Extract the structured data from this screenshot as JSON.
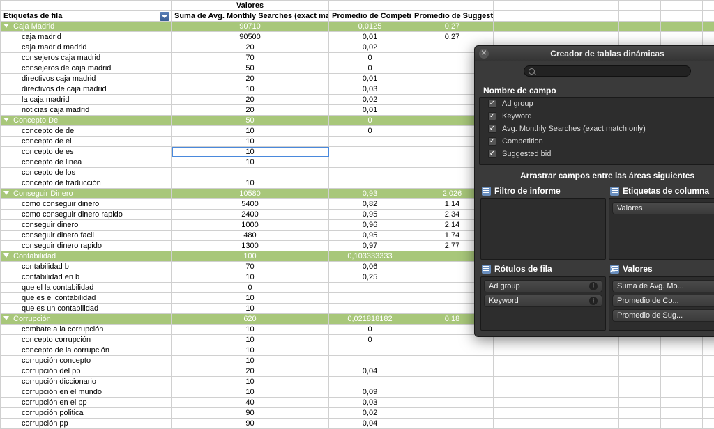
{
  "headers": {
    "row_labels": "Etiquetas de fila",
    "values": "Valores",
    "col_b": "Suma de Avg. Monthly Searches (exact match only)",
    "col_c": "Promedio de Competition",
    "col_d": "Promedio de Suggested bid"
  },
  "rows": [
    {
      "type": "group",
      "label": "Caja Madrid",
      "b": "90710",
      "c": "0,0125",
      "d": "0,27"
    },
    {
      "type": "child",
      "label": "caja madrid",
      "b": "90500",
      "c": "0,01",
      "d": "0,27"
    },
    {
      "type": "child",
      "label": "caja madrid madrid",
      "b": "20",
      "c": "0,02",
      "d": ""
    },
    {
      "type": "child",
      "label": "consejeros caja madrid",
      "b": "70",
      "c": "0",
      "d": ""
    },
    {
      "type": "child",
      "label": "consejeros de caja madrid",
      "b": "50",
      "c": "0",
      "d": ""
    },
    {
      "type": "child",
      "label": "directivos caja madrid",
      "b": "20",
      "c": "0,01",
      "d": ""
    },
    {
      "type": "child",
      "label": "directivos de caja madrid",
      "b": "10",
      "c": "0,03",
      "d": ""
    },
    {
      "type": "child",
      "label": "la caja madrid",
      "b": "20",
      "c": "0,02",
      "d": ""
    },
    {
      "type": "child",
      "label": "noticias caja madrid",
      "b": "20",
      "c": "0,01",
      "d": ""
    },
    {
      "type": "group",
      "label": "Concepto De",
      "b": "50",
      "c": "0",
      "d": ""
    },
    {
      "type": "child",
      "label": "concepto de de",
      "b": "10",
      "c": "0",
      "d": ""
    },
    {
      "type": "child",
      "label": "concepto de el",
      "b": "10",
      "c": "",
      "d": ""
    },
    {
      "type": "child",
      "label": "concepto de es",
      "b": "10",
      "c": "",
      "d": "",
      "selected": true
    },
    {
      "type": "child",
      "label": "concepto de linea",
      "b": "10",
      "c": "",
      "d": ""
    },
    {
      "type": "child",
      "label": "concepto de los",
      "b": "",
      "c": "",
      "d": ""
    },
    {
      "type": "child",
      "label": "concepto de traducción",
      "b": "10",
      "c": "",
      "d": ""
    },
    {
      "type": "group",
      "label": "Conseguir Dinero",
      "b": "10580",
      "c": "0,93",
      "d": "2,026"
    },
    {
      "type": "child",
      "label": "como conseguir dinero",
      "b": "5400",
      "c": "0,82",
      "d": "1,14"
    },
    {
      "type": "child",
      "label": "como conseguir dinero rapido",
      "b": "2400",
      "c": "0,95",
      "d": "2,34"
    },
    {
      "type": "child",
      "label": "conseguir dinero",
      "b": "1000",
      "c": "0,96",
      "d": "2,14"
    },
    {
      "type": "child",
      "label": "conseguir dinero facil",
      "b": "480",
      "c": "0,95",
      "d": "1,74"
    },
    {
      "type": "child",
      "label": "conseguir dinero rapido",
      "b": "1300",
      "c": "0,97",
      "d": "2,77"
    },
    {
      "type": "group",
      "label": "Contabilidad",
      "b": "100",
      "c": "0,103333333",
      "d": ""
    },
    {
      "type": "child",
      "label": "contabilidad b",
      "b": "70",
      "c": "0,06",
      "d": ""
    },
    {
      "type": "child",
      "label": "contabilidad en b",
      "b": "10",
      "c": "0,25",
      "d": ""
    },
    {
      "type": "child",
      "label": "que el la contabilidad",
      "b": "0",
      "c": "",
      "d": ""
    },
    {
      "type": "child",
      "label": "que es el contabilidad",
      "b": "10",
      "c": "",
      "d": ""
    },
    {
      "type": "child",
      "label": "que es un contabilidad",
      "b": "10",
      "c": "",
      "d": ""
    },
    {
      "type": "group",
      "label": "Corrupción",
      "b": "620",
      "c": "0,021818182",
      "d": "0,18"
    },
    {
      "type": "child",
      "label": "combate a la corrupción",
      "b": "10",
      "c": "0",
      "d": ""
    },
    {
      "type": "child",
      "label": "concepto corrupción",
      "b": "10",
      "c": "0",
      "d": ""
    },
    {
      "type": "child",
      "label": "concepto de la corrupción",
      "b": "10",
      "c": "",
      "d": ""
    },
    {
      "type": "child",
      "label": "corrupción concepto",
      "b": "10",
      "c": "",
      "d": ""
    },
    {
      "type": "child",
      "label": "corrupción del pp",
      "b": "20",
      "c": "0,04",
      "d": ""
    },
    {
      "type": "child",
      "label": "corrupción diccionario",
      "b": "10",
      "c": "",
      "d": ""
    },
    {
      "type": "child",
      "label": "corrupción en el mundo",
      "b": "10",
      "c": "0,09",
      "d": ""
    },
    {
      "type": "child",
      "label": "corrupción en el pp",
      "b": "40",
      "c": "0,03",
      "d": ""
    },
    {
      "type": "child",
      "label": "corrupción politica",
      "b": "90",
      "c": "0,02",
      "d": ""
    },
    {
      "type": "child",
      "label": "corrupción pp",
      "b": "90",
      "c": "0,04",
      "d": ""
    }
  ],
  "panel": {
    "title": "Creador de tablas dinámicas",
    "field_name_label": "Nombre de campo",
    "fields": [
      {
        "label": "Ad group",
        "checked": true
      },
      {
        "label": "Keyword",
        "checked": true
      },
      {
        "label": "Avg. Monthly Searches (exact match only)",
        "checked": true
      },
      {
        "label": "Competition",
        "checked": true
      },
      {
        "label": "Suggested bid",
        "checked": true
      }
    ],
    "drag_hint": "Arrastrar campos entre las áreas siguientes",
    "areas": {
      "filter": "Filtro de informe",
      "cols": "Etiquetas de columna",
      "rows": "Rótulos de fila",
      "vals": "Valores"
    },
    "col_items": [
      "Valores"
    ],
    "row_items": [
      "Ad group",
      "Keyword"
    ],
    "val_items": [
      "Suma de Avg. Mo...",
      "Promedio de Co...",
      "Promedio de Sug..."
    ]
  }
}
